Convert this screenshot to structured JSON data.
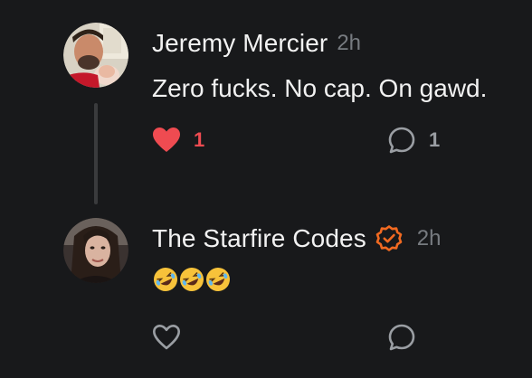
{
  "comments": [
    {
      "author": "Jeremy Mercier",
      "time": "2h",
      "text": "Zero fucks. No cap. On gawd.",
      "likes": "1",
      "replies": "1",
      "liked": true
    },
    {
      "author": "The Starfire Codes",
      "time": "2h",
      "verified": true,
      "emojis": [
        "rolling-on-floor-laughing",
        "rolling-on-floor-laughing",
        "rolling-on-floor-laughing"
      ],
      "liked": false
    }
  ],
  "colors": {
    "background": "#18191b",
    "like_active": "#ef4b51",
    "verified_badge": "#f26a21",
    "icon_inactive": "#9a9ea3",
    "timestamp": "#777b80"
  }
}
